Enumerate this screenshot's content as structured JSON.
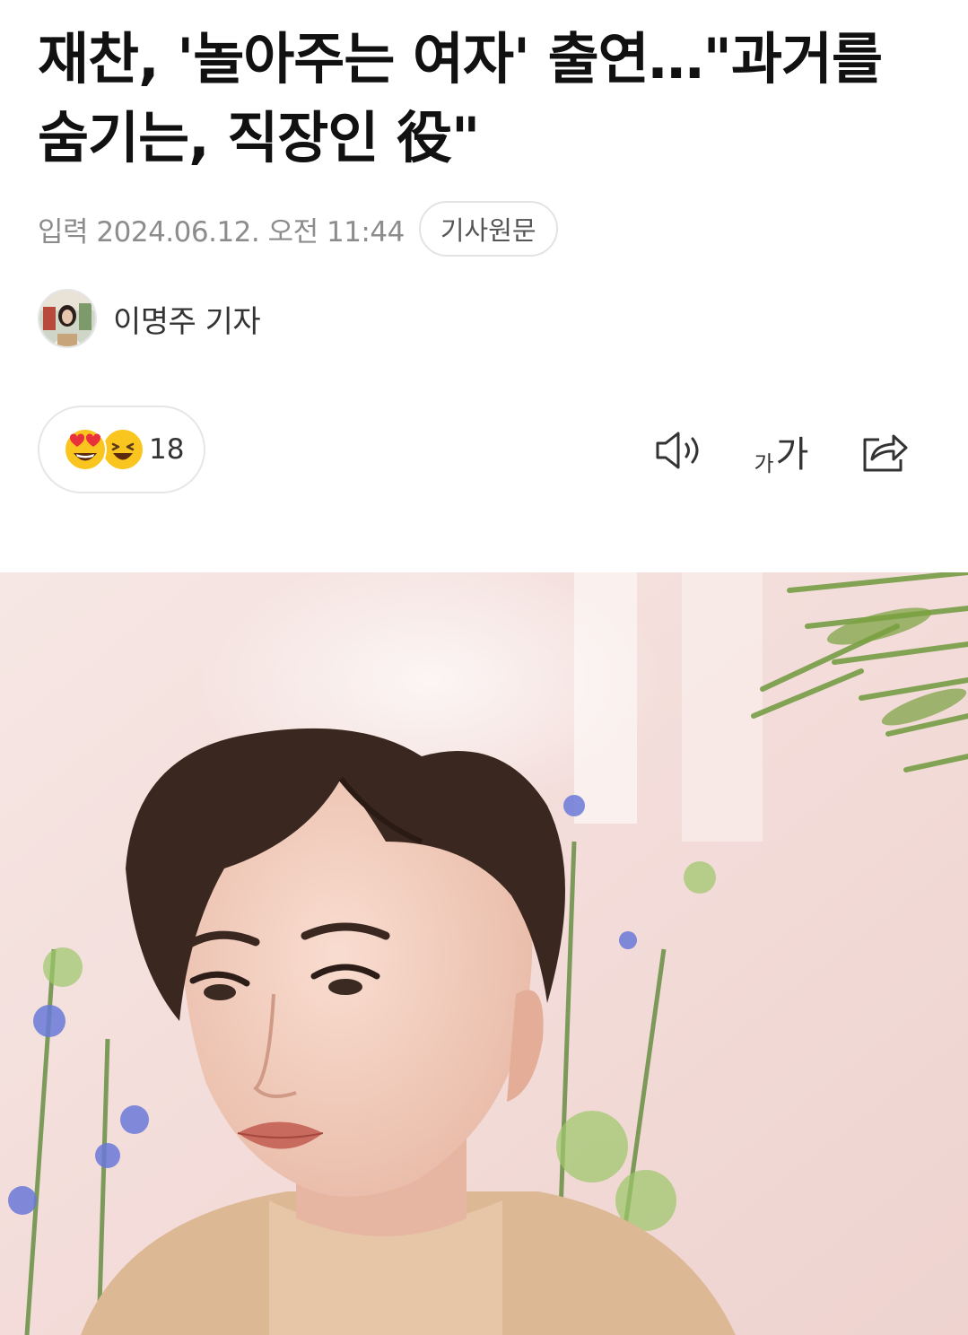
{
  "article": {
    "title": "재찬, '놀아주는 여자' 출연…\"과거를 숨기는, 직장인 役\"",
    "published": "입력 2024.06.12. 오전 11:44",
    "original_button": "기사원문",
    "author": "이명주 기자"
  },
  "reactions": {
    "icons": [
      "heart-eyes-emoji-icon",
      "laughing-emoji-icon"
    ],
    "count": "18"
  },
  "toolbar": {
    "tts_icon": "speaker-icon",
    "font_small": "가",
    "font_large": "가",
    "share_icon": "share-icon"
  },
  "colors": {
    "meta_gray": "#8c8c8c",
    "border": "#e6e6e6",
    "emoji_yellow": "#f9c51e",
    "heart_red": "#e8313b"
  }
}
